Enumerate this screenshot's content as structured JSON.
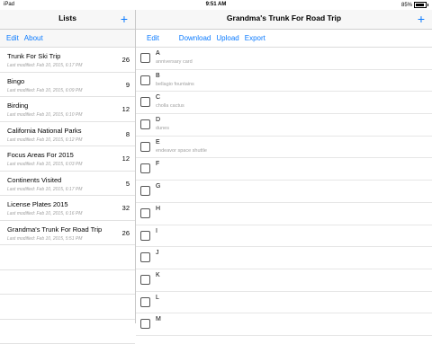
{
  "status": {
    "carrier": "iPad",
    "time": "9:51 AM",
    "battery_percent": "85%",
    "battery_level": 0.85
  },
  "lists_panel": {
    "title": "Lists",
    "add": "+",
    "edit_label": "Edit",
    "about_label": "About",
    "items": [
      {
        "name": "Trunk For Ski Trip",
        "modified": "Last modified: Feb 10, 2015, 6:17 PM",
        "count": "26"
      },
      {
        "name": "Bingo",
        "modified": "Last modified: Feb 10, 2015, 6:09 PM",
        "count": "9"
      },
      {
        "name": "Birding",
        "modified": "Last modified: Feb 10, 2015, 6:10 PM",
        "count": "12"
      },
      {
        "name": "California National Parks",
        "modified": "Last modified: Feb 10, 2015, 6:12 PM",
        "count": "8"
      },
      {
        "name": "Focus Areas For 2015",
        "modified": "Last modified: Feb 10, 2015, 6:03 PM",
        "count": "12"
      },
      {
        "name": "Continents Visited",
        "modified": "Last modified: Feb 10, 2015, 6:17 PM",
        "count": "5"
      },
      {
        "name": "License Plates 2015",
        "modified": "Last modified: Feb 10, 2015, 6:16 PM",
        "count": "32"
      },
      {
        "name": "Grandma's Trunk For Road Trip",
        "modified": "Last modified: Feb 10, 2015, 5:51 PM",
        "count": "26"
      }
    ]
  },
  "detail_panel": {
    "title": "Grandma's Trunk For Road Trip",
    "add": "+",
    "edit_label": "Edit",
    "download_label": "Download",
    "upload_label": "Upload",
    "export_label": "Export",
    "items": [
      {
        "letter": "A",
        "note": "anniversary card"
      },
      {
        "letter": "B",
        "note": "bellagio fountains"
      },
      {
        "letter": "C",
        "note": "cholla cactus"
      },
      {
        "letter": "D",
        "note": "dunes"
      },
      {
        "letter": "E",
        "note": "endeavor space shuttle"
      },
      {
        "letter": "F",
        "note": ""
      },
      {
        "letter": "G",
        "note": ""
      },
      {
        "letter": "H",
        "note": ""
      },
      {
        "letter": "I",
        "note": ""
      },
      {
        "letter": "J",
        "note": ""
      },
      {
        "letter": "K",
        "note": ""
      },
      {
        "letter": "L",
        "note": ""
      },
      {
        "letter": "M",
        "note": ""
      }
    ]
  },
  "colors": {
    "accent": "#0a7aff",
    "secondary_text": "#a0a0a0"
  }
}
